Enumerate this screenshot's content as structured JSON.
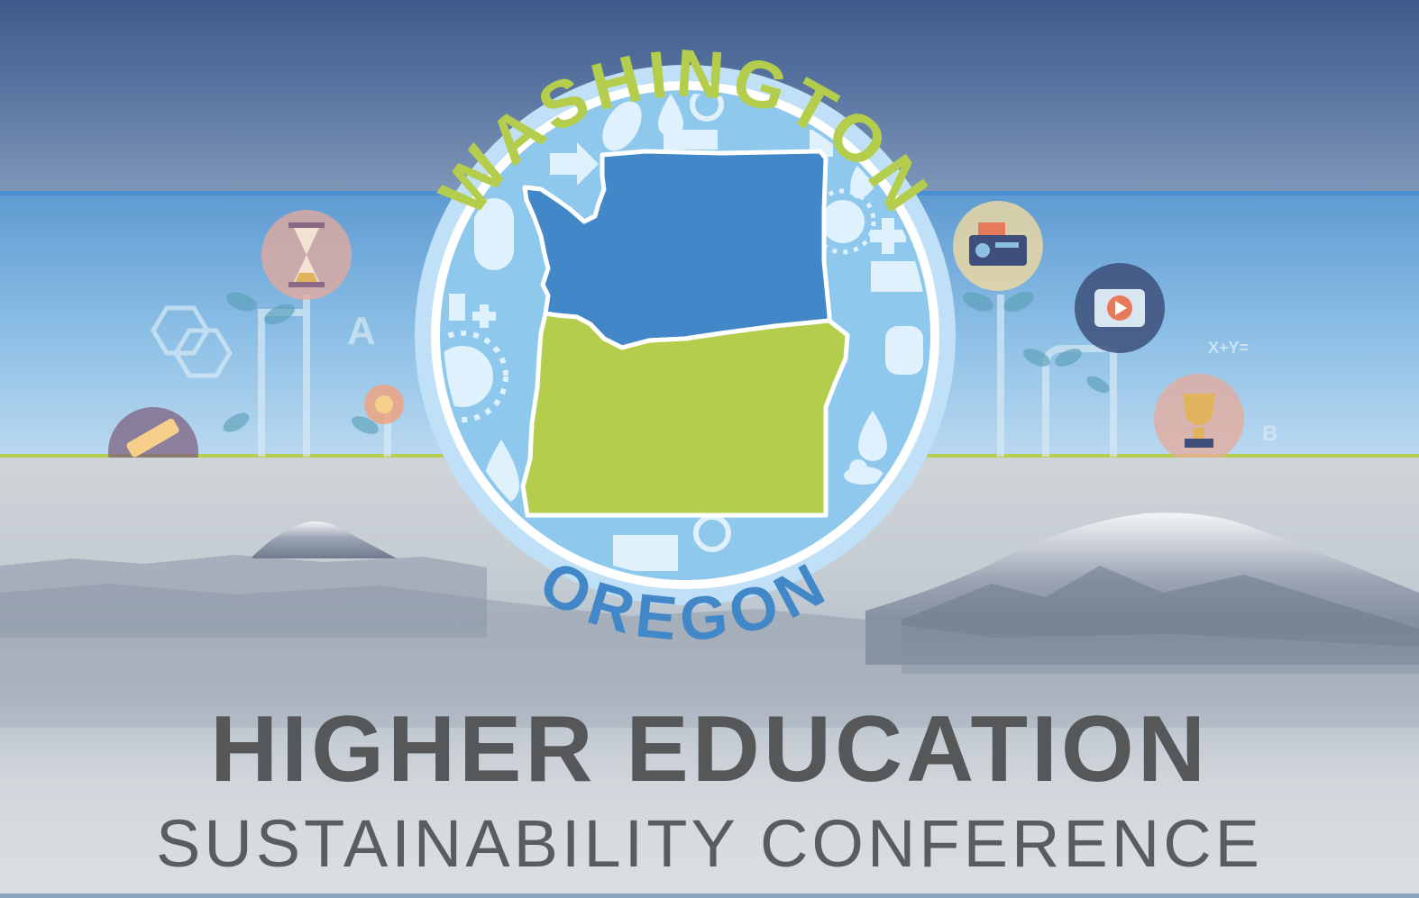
{
  "logo": {
    "state_top": "WASHINGTON",
    "state_bottom": "OREGON",
    "colors": {
      "washington": "#4287c8",
      "oregon": "#b5cd4c",
      "ring": "#bfe0f6",
      "badge_bg": "#8ec8ec"
    }
  },
  "title": {
    "line1": "HIGHER EDUCATION",
    "line2": "SUSTAINABILITY CONFERENCE"
  },
  "icons": [
    "hourglass-icon",
    "hexagon-icon",
    "pencil-icon",
    "flower-icon",
    "radio-icon",
    "play-icon",
    "trophy-icon",
    "sun-icon",
    "recycle-icon",
    "water-drop-icon",
    "solar-panel-icon",
    "hand-icon"
  ],
  "band_text": {
    "letter_a": "A",
    "letter_b": "B",
    "formula": "X+Y="
  }
}
